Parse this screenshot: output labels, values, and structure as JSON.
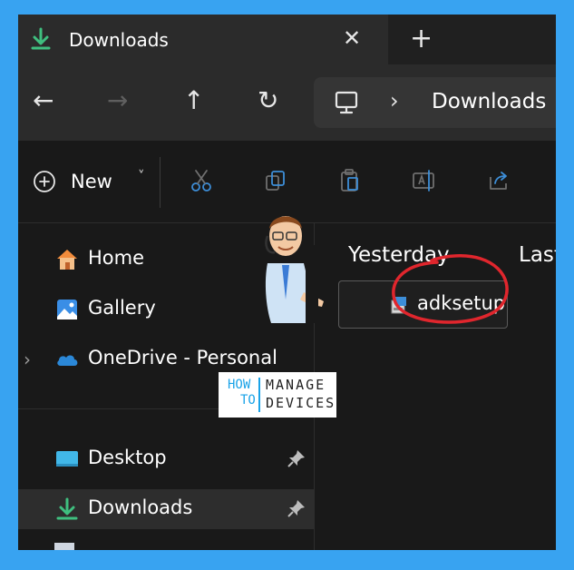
{
  "tab": {
    "title": "Downloads",
    "close_glyph": "✕",
    "new_tab_glyph": "+"
  },
  "nav": {
    "back": "←",
    "forward": "→",
    "up": "↑",
    "refresh": "↻"
  },
  "address": {
    "separator": "›",
    "path": "Downloads"
  },
  "toolbar": {
    "new_label": "New",
    "new_chevron": "˅"
  },
  "sidebar": {
    "expand_glyph": "›",
    "items": [
      {
        "label": "Home",
        "icon": "home-icon"
      },
      {
        "label": "Gallery",
        "icon": "gallery-icon"
      },
      {
        "label": "OneDrive - Personal",
        "icon": "cloud-icon"
      },
      {
        "label": "Desktop",
        "icon": "desktop-icon"
      },
      {
        "label": "Downloads",
        "icon": "download-icon"
      }
    ]
  },
  "content": {
    "group_headers": [
      "Yesterday",
      "Last"
    ],
    "files": [
      {
        "name": "adksetup",
        "icon": "installer-icon"
      }
    ]
  },
  "logo": {
    "how": "HOW",
    "to": "TO",
    "manage": "MANAGE",
    "devices": "DEVICES"
  },
  "colors": {
    "frame": "#38a3f1",
    "accent_green": "#3fbf7f",
    "annotation_red": "#e0262d"
  }
}
